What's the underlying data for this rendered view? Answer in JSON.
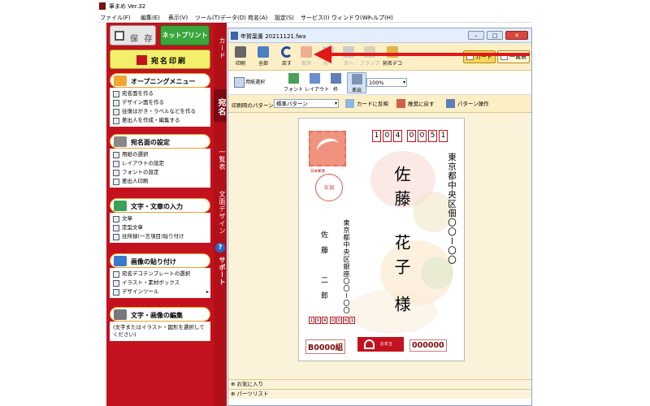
{
  "app": {
    "title": "筆まめ Ver.32"
  },
  "menu": [
    "ファイル(F)",
    "編集(E)",
    "表示(V)",
    "ツール(T)",
    "データ(D)",
    "宛名(A)",
    "設定(S)",
    "サービス(I)",
    "ウィンドウ(W)",
    "ヘルプ(H)"
  ],
  "left": {
    "save_label": "保 存",
    "netprint_label": "ネットプリント",
    "atena_print_label": "宛名印刷",
    "sections": [
      {
        "title": "オープニングメニュー",
        "items": [
          "宛名面を作る",
          "デザイン面を作る",
          "往復はがき・ラベルなどを作る",
          "差出人を作成・編集する"
        ]
      },
      {
        "title": "宛名面の設定",
        "items": [
          "用紙の選択",
          "レイアウトの設定",
          "フォントの設定",
          "差出人印刷"
        ]
      },
      {
        "title": "文字・文章の入力",
        "items": [
          "文章",
          "定型文章",
          "住所録(一言項目)貼り付け"
        ]
      },
      {
        "title": "画像の貼り付け",
        "items": [
          "宛名デコテンプレートの選択",
          "イラスト・素材ボックス",
          "デザインツール"
        ]
      },
      {
        "title": "文字・画像の編集",
        "items": [
          "(文字またはイラスト・図形を選択してください)"
        ]
      }
    ]
  },
  "tabs": [
    "カード",
    "宛名",
    "一覧表",
    "文面デザイン",
    "サポート"
  ],
  "doc": {
    "title": "年賀葉書 20211121.fwa",
    "toolbar1": [
      "印刷",
      "全部",
      "戻す",
      "取消",
      "前へ",
      "次へ",
      "フラップ",
      "宛名デコ"
    ],
    "view_card": "カード",
    "view_list": "一覧表",
    "toolbar2": [
      "用紙選択",
      "フォント",
      "レイアウト",
      "枠",
      "差出"
    ],
    "zoom": "100%",
    "pattern_label": "印刷時のパターン",
    "pattern_value": "標準パターン",
    "card_reflect": "カードに反映",
    "restore_default": "推奨に戻す",
    "pattern_ops": "パターン操作",
    "bottom1": "お気に入り",
    "bottom2": "パーツリスト"
  },
  "postcard": {
    "zip": [
      "1",
      "0",
      "4",
      "0",
      "0",
      "5",
      "1"
    ],
    "recipient_address": "東京都中央区佃〇〇ー〇〇",
    "recipient_name1": "佐藤",
    "recipient_name2": "花子",
    "honorific": "様",
    "sender_address": "東京都中央区銀座〇〇ー〇〇",
    "sender_name1": "佐藤",
    "sender_name2": "二郎",
    "sender_zip": [
      "1",
      "0",
      "4",
      "0",
      "0",
      "6",
      "1"
    ],
    "nenga": "年賀",
    "stamp_caption": "日本郵便",
    "lottery_left": "B0000組",
    "lottery_right": "000000",
    "seal_text": "お年玉"
  },
  "colors": {
    "brand_red": "#c3121e",
    "accent_yellow": "#f3ef6a",
    "netprint_green": "#3ba63b"
  }
}
